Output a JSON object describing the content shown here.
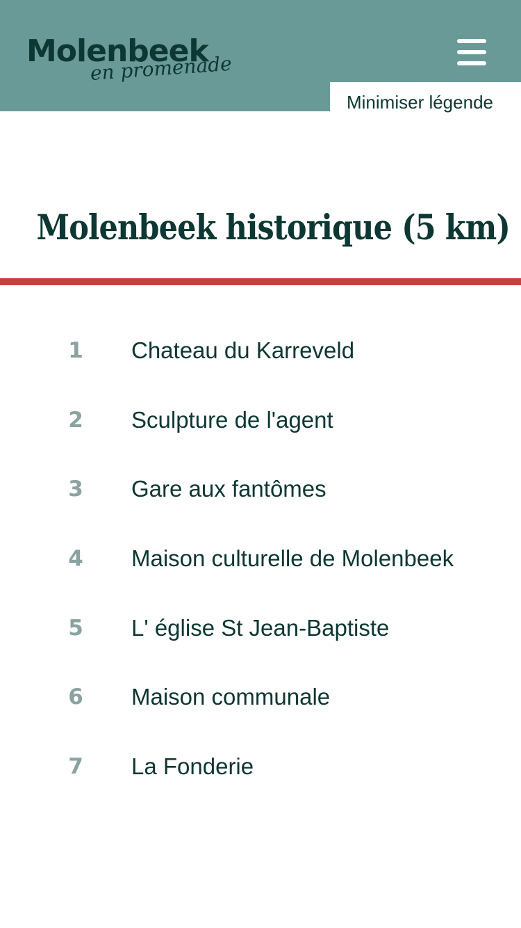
{
  "header": {
    "logo": {
      "main": "Molenbeek",
      "sub": "en promenade"
    },
    "menu_icon": "hamburger-menu-icon",
    "legend_toggle_label": "Minimiser légende"
  },
  "route": {
    "title": "Molenbeek historique (5 km)"
  },
  "colors": {
    "header_bg": "#6a9a98",
    "accent_divider": "#c5403f",
    "text_dark": "#0d3732",
    "number_gray": "#8aa3a1"
  },
  "stops": [
    {
      "number": "1",
      "name": "Chateau du Karreveld"
    },
    {
      "number": "2",
      "name": "Sculpture de l'agent"
    },
    {
      "number": "3",
      "name": "Gare aux fantômes"
    },
    {
      "number": "4",
      "name": "Maison culturelle de Molenbeek"
    },
    {
      "number": "5",
      "name": "L' église St Jean-Baptiste"
    },
    {
      "number": "6",
      "name": "Maison communale"
    },
    {
      "number": "7",
      "name": "La Fonderie"
    }
  ]
}
